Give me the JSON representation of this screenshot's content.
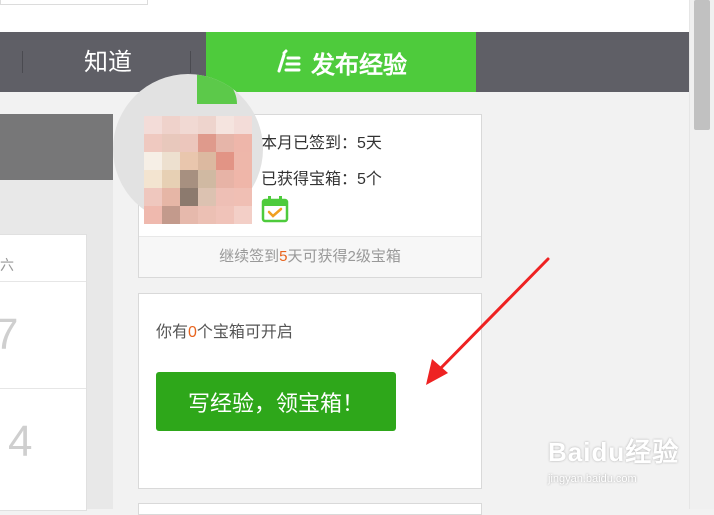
{
  "nav": {
    "zhidao_label": "知道",
    "publish_label": "发布经验"
  },
  "checkin": {
    "month_signed_label": "本月已签到：5天",
    "chests_obtained_label": "已获得宝箱：5个",
    "footer_prefix": "继续签到",
    "footer_num": "5",
    "footer_suffix": "天可获得2级宝箱"
  },
  "chests": {
    "text_prefix": "你有",
    "text_num": "0",
    "text_suffix": "个宝箱可开启",
    "button_label": "写经验，领宝箱！"
  },
  "calendar": {
    "weekday": "六",
    "days": [
      "7",
      "4"
    ]
  },
  "watermark": {
    "brand": "Baidu经验",
    "url": "jingyan.baidu.com"
  },
  "colors": {
    "nav_bg": "#5f5f66",
    "publish_green": "#4ecb3c",
    "button_green": "#2ea71a",
    "highlight_orange": "#e8641e",
    "arrow_red": "#ee2222"
  }
}
